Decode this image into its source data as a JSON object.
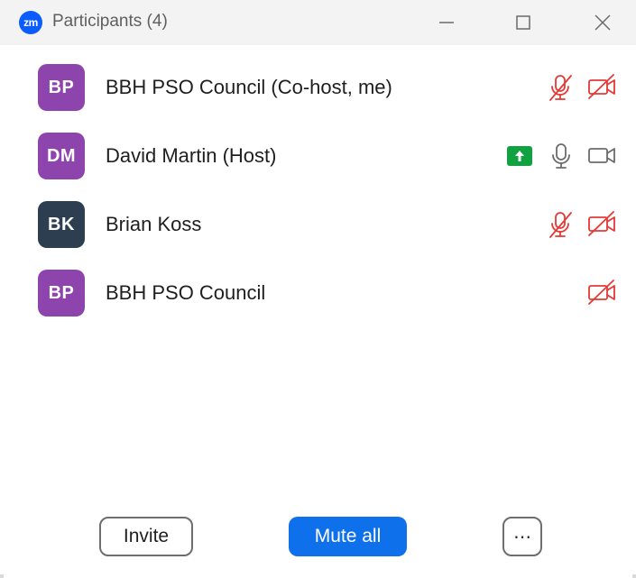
{
  "window": {
    "title": "Participants (4)",
    "app_logo_text": "zm"
  },
  "participants": [
    {
      "initials": "BP",
      "name": "BBH PSO Council (Co-host, me)",
      "avatar_color": "#8e44ad",
      "mic": "muted",
      "video": "off",
      "sharing": false
    },
    {
      "initials": "DM",
      "name": "David Martin (Host)",
      "avatar_color": "#8e44ad",
      "mic": "on",
      "video": "on",
      "sharing": true
    },
    {
      "initials": "BK",
      "name": "Brian Koss",
      "avatar_color": "#2c3e50",
      "mic": "muted",
      "video": "off",
      "sharing": false
    },
    {
      "initials": "BP",
      "name": "BBH PSO Council",
      "avatar_color": "#8e44ad",
      "mic": "none",
      "video": "off",
      "sharing": false
    }
  ],
  "footer": {
    "invite_label": "Invite",
    "mute_all_label": "Mute all",
    "more_label": "⋯"
  },
  "colors": {
    "accent": "#0e71eb",
    "muted_red": "#e53935",
    "share_green": "#12a140",
    "titlebar_bg": "#f3f3f3"
  },
  "icons": [
    "minimize-icon",
    "maximize-icon",
    "close-icon",
    "mic-muted-icon",
    "video-off-icon",
    "mic-icon",
    "video-icon",
    "share-screen-icon"
  ]
}
